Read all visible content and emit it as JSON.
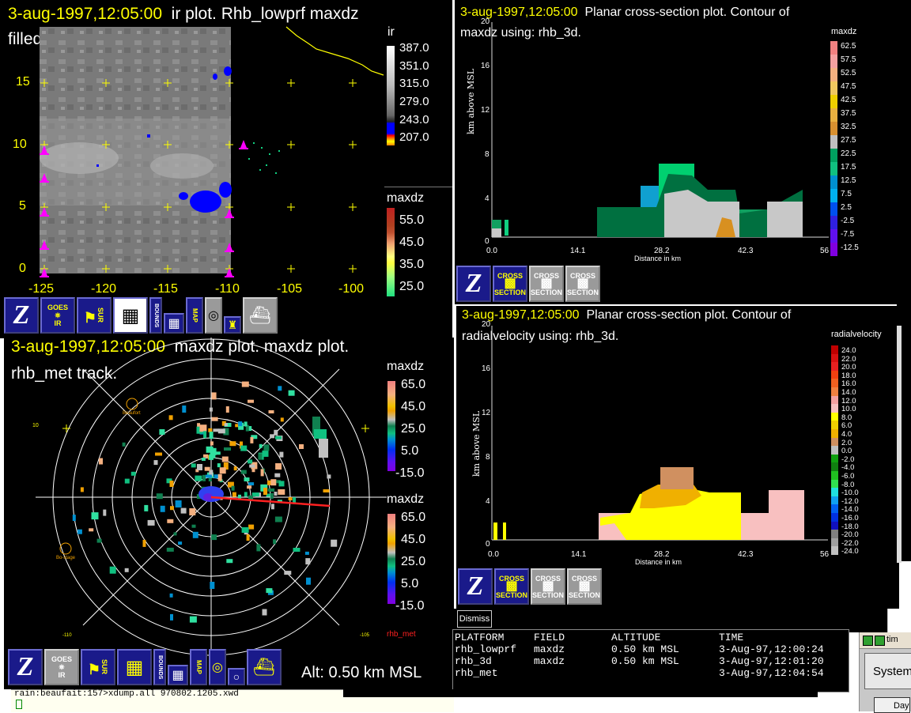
{
  "win_ir": {
    "title_line1": "3-aug-1997,12:05:00  ir plot.  Rhb_lowprf maxdz",
    "title_date": "3-aug-1997,12:05:00",
    "title_rest": "ir plot.  Rhb_lowprf maxdz",
    "title_line2": "filled contour.",
    "ylabels": [
      "15",
      "10",
      "5",
      "0"
    ],
    "xlabels": [
      "-125",
      "-120",
      "-115",
      "-110",
      "-105",
      "-100"
    ],
    "ir_legend_title": "ir",
    "ir_legend": [
      "387.0",
      "351.0",
      "315.0",
      "279.0",
      "243.0",
      "207.0"
    ],
    "maxdz_legend_title": "maxdz",
    "maxdz_legend": [
      "55.0",
      "45.0",
      "35.0",
      "25.0"
    ]
  },
  "win_maxdz_cs": {
    "title_date": "3-aug-1997,12:05:00",
    "title_rest": "Planar cross-section plot.  Contour of",
    "title_line2": "maxdz using: rhb_3d.",
    "legend_title": "maxdz",
    "legend": [
      "62.5",
      "57.5",
      "52.5",
      "47.5",
      "42.5",
      "37.5",
      "32.5",
      "27.5",
      "22.5",
      "17.5",
      "12.5",
      "7.5",
      "2.5",
      "-2.5",
      "-7.5",
      "-12.5"
    ],
    "legend_colors": [
      "#f08080",
      "#f4a0a0",
      "#f4b080",
      "#f0c860",
      "#f0d000",
      "#e8b040",
      "#d89030",
      "#c0c0c0",
      "#00a060",
      "#10c080",
      "#0090d0",
      "#00b0f0",
      "#0050f0",
      "#3020e0",
      "#6010f0",
      "#8000e0"
    ],
    "yaxis_label": "km above MSL",
    "xaxis_label": "Distance in km",
    "yticks": [
      "20",
      "16",
      "12",
      "8",
      "4",
      "0"
    ],
    "xticks": [
      "0.0",
      "14.1",
      "28.2",
      "42.3",
      "56"
    ]
  },
  "win_rv_cs": {
    "title_date": "3-aug-1997,12:05:00",
    "title_rest": "Planar cross-section plot.  Contour of",
    "title_line2": "radialvelocity using: rhb_3d.",
    "legend_title": "radialvelocity",
    "legend": [
      "24.0",
      "22.0",
      "20.0",
      "18.0",
      "16.0",
      "14.0",
      "12.0",
      "10.0",
      "8.0",
      "6.0",
      "4.0",
      "2.0",
      "0.0",
      "-2.0",
      "-4.0",
      "-6.0",
      "-8.0",
      "-10.0",
      "-12.0",
      "-14.0",
      "-16.0",
      "-18.0",
      "-20.0",
      "-22.0",
      "-24.0"
    ],
    "legend_colors": [
      "#c00000",
      "#d81010",
      "#e82020",
      "#f04010",
      "#f06020",
      "#f08040",
      "#f4a0a0",
      "#f8c0c0",
      "#ffff00",
      "#f0d000",
      "#f0b000",
      "#d09060",
      "#c0c0c0",
      "#10a010",
      "#108010",
      "#20c020",
      "#30e050",
      "#20e0e0",
      "#10a0f0",
      "#0060f0",
      "#0030e0",
      "#1010c0",
      "#808080",
      "#a0a0a0",
      "#c0c0c0"
    ],
    "yaxis_label": "km above MSL",
    "xaxis_label": "Distance in km",
    "yticks": [
      "20",
      "16",
      "12",
      "8",
      "4",
      "0"
    ],
    "xticks": [
      "0.0",
      "14.1",
      "28.2",
      "42.3",
      "56"
    ]
  },
  "win_radar": {
    "title_date": "3-aug-1997,12:05:00",
    "title_rest": "maxdz plot.  maxdz plot.",
    "title_line2": "rhb_met track.",
    "legend1_title": "maxdz",
    "legend1": [
      "65.0",
      "45.0",
      "25.0",
      "5.0",
      "-15.0"
    ],
    "legend2_title": "maxdz",
    "legend2": [
      "65.0",
      "45.0",
      "25.0",
      "5.0",
      "-15.0"
    ],
    "track_label": "rhb_met",
    "alt_label": "Alt: 0.50 km MSL",
    "coord_left": "-110",
    "coord_right": "-105",
    "lat_label": "10",
    "marker1": "Beaufort",
    "marker2": "Bo-stage"
  },
  "toolbar": {
    "goes_label": "GOES",
    "ir_label": "IR",
    "sur_label": "SUR",
    "bounds_label": "BOUNDS",
    "map_label": "MAP",
    "cross_label": "CROSS",
    "section_label": "SECTION"
  },
  "dismiss_label": "Dismiss",
  "info_table": {
    "headers": [
      "PLATFORM",
      "FIELD",
      "ALTITUDE",
      "TIME"
    ],
    "rows": [
      [
        "rhb_lowprf",
        "maxdz",
        "0.50 km MSL",
        "3-Aug-97,12:00:24"
      ],
      [
        "rhb_3d",
        "maxdz",
        "0.50 km MSL",
        "3-Aug-97,12:01:20"
      ],
      [
        "rhb_met",
        "",
        "",
        "3-Aug-97,12:04:54"
      ]
    ]
  },
  "terminal": {
    "line1": "rain:beaufait:157>xdump.all 970802.1205.xwd"
  },
  "side": {
    "title": "tim",
    "button1": "System",
    "button2": "Day"
  }
}
